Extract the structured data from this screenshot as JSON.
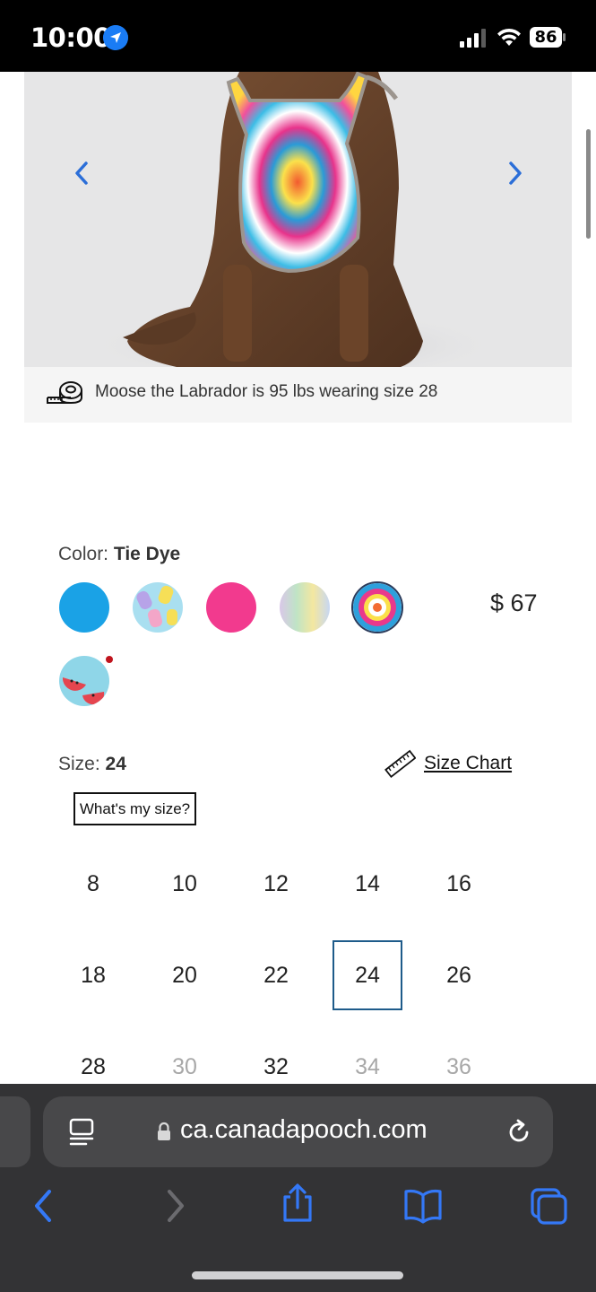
{
  "status_bar": {
    "time": "10:00",
    "battery": "86"
  },
  "product": {
    "image_alt": "Labrador wearing tie dye harness",
    "info_text": "Moose the Labrador is 95 lbs wearing size 28"
  },
  "color": {
    "label": "Color:",
    "selected": "Tie Dye",
    "price": "$ 67"
  },
  "size": {
    "label": "Size:",
    "selected": "24",
    "chart_link": "Size Chart",
    "whats_my_size": "What's my size?",
    "options": [
      "8",
      "10",
      "12",
      "14",
      "16",
      "18",
      "20",
      "22",
      "24",
      "26",
      "28",
      "30",
      "32",
      "34",
      "36"
    ],
    "unavailable": [
      "30",
      "34",
      "36"
    ]
  },
  "browser": {
    "url": "ca.canadapooch.com"
  },
  "colors": {
    "accent": "#2b6cb0",
    "selected_border": "#1e5b8a",
    "ios_blue": "#3478f6"
  }
}
